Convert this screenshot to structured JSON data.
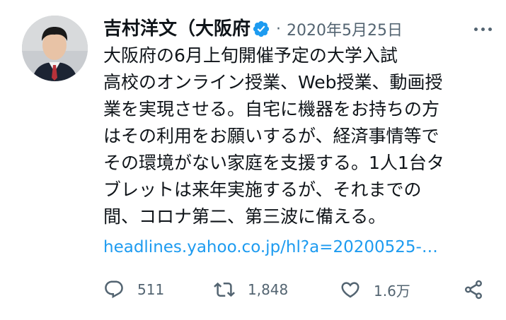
{
  "tweet": {
    "author_name": "吉村洋文（大阪府",
    "separator": "·",
    "date": "2020年5月25日",
    "text_lines": [
      "大阪府の6月上旬開催予定の大学入試",
      "高校のオンライン授業、Web授業、動画授",
      "業を実現させる。自宅に機器をお持ちの方",
      "はその利用をお願いするが、経済事情等で",
      "その環境がない家庭を支援する。1人1台タ",
      "ブレットは来年実施するが、それまでの",
      "間、コロナ第二、第三波に備える。"
    ],
    "link": "headlines.yahoo.co.jp/hl?a=20200525-…"
  },
  "actions": {
    "reply_count": "511",
    "retweet_count": "1,848",
    "like_count": "1.6万"
  },
  "colors": {
    "text": "#0f1419",
    "secondary": "#536471",
    "link": "#1d9bf0",
    "verified": "#1d9bf0"
  },
  "icons": [
    "verified-badge-icon",
    "more-icon",
    "reply-icon",
    "retweet-icon",
    "like-icon",
    "share-icon"
  ]
}
